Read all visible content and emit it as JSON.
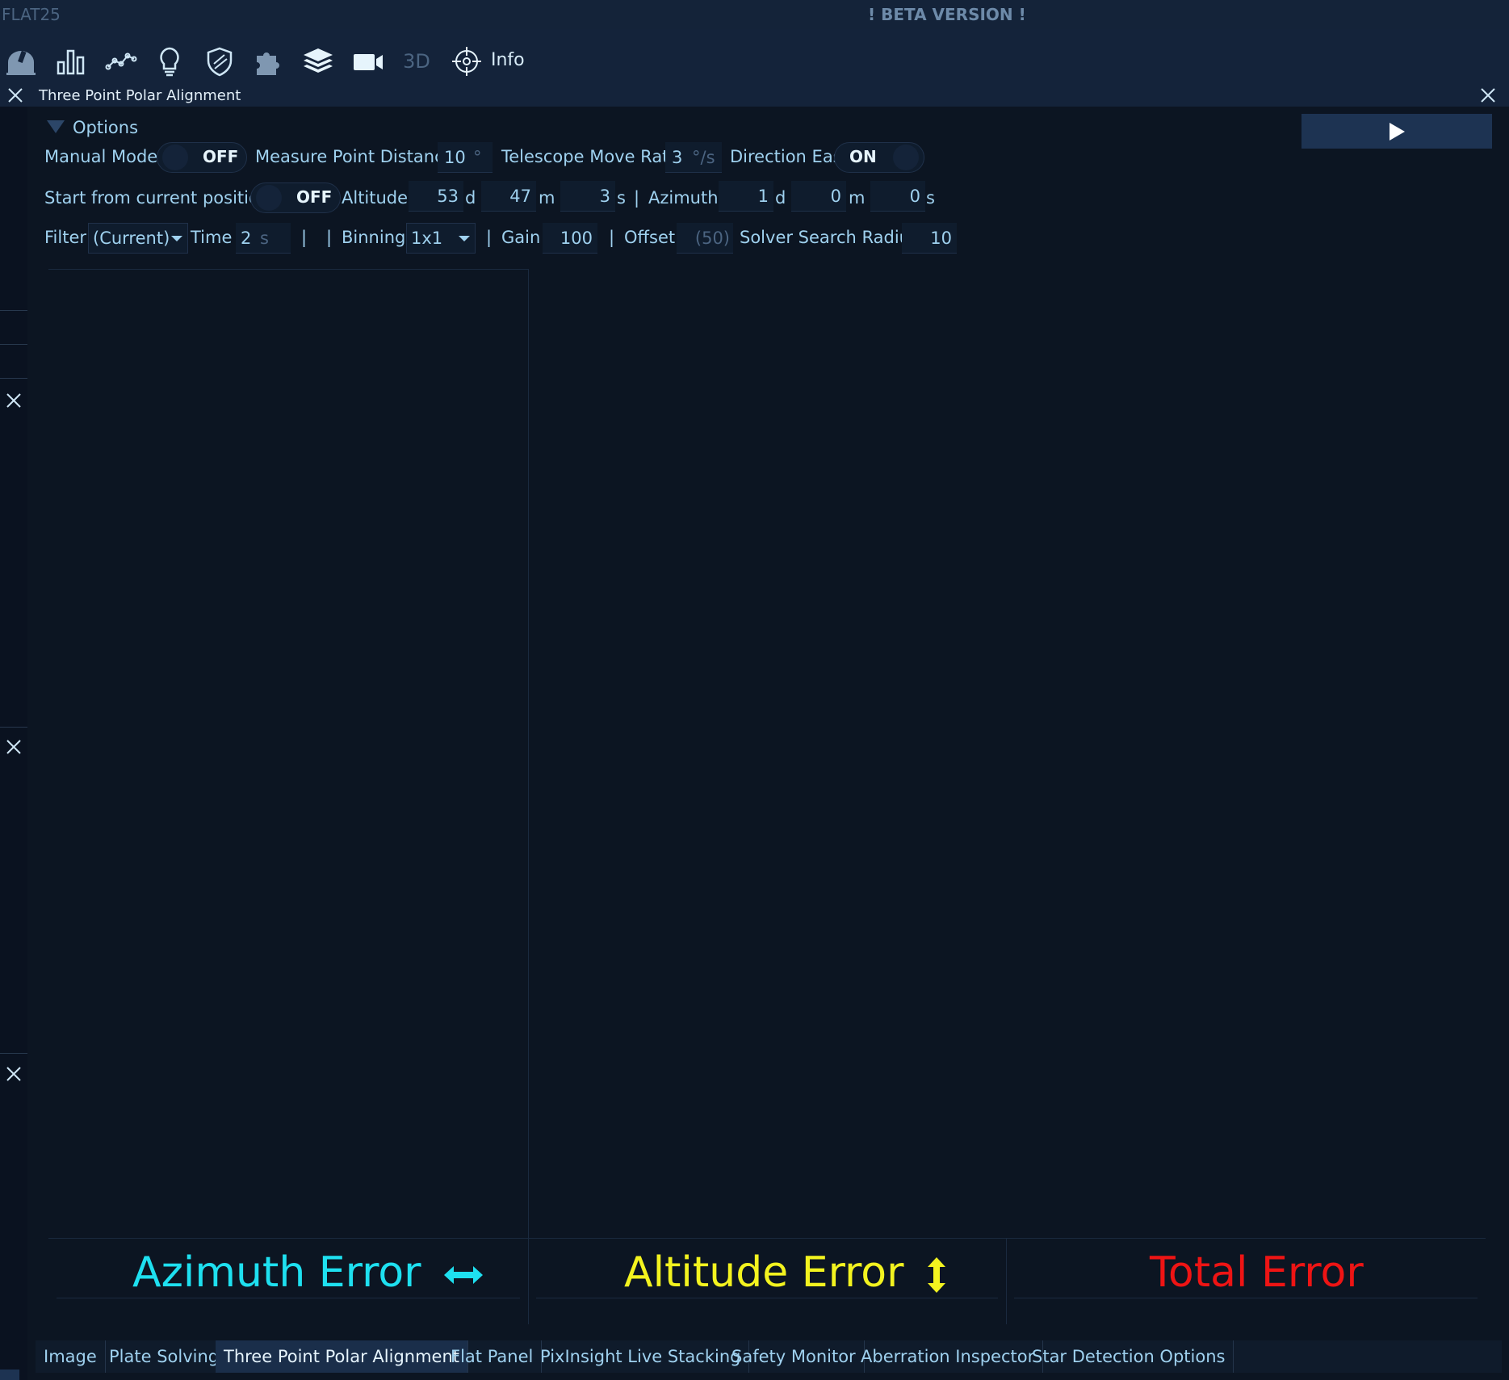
{
  "titlebar": {
    "app_name": "FLAT25",
    "banner": "! BETA VERSION !"
  },
  "toolbar": {
    "icons": [
      "observatory-icon",
      "bar-chart-icon",
      "graph-icon",
      "lightbulb-icon",
      "shield-icon",
      "puzzle-icon",
      "layers-icon",
      "video-camera-icon",
      "3d-icon",
      "crosshair-icon"
    ],
    "three_d_label": "3D",
    "info_label": "Info"
  },
  "panel": {
    "title": "Three Point Polar Alignment"
  },
  "options": {
    "header": "Options",
    "manual_mode_label": "Manual Mode?",
    "manual_mode_state": "OFF",
    "measure_point_distance_label": "Measure Point Distance",
    "measure_point_distance_value": "10",
    "measure_point_distance_unit": "°",
    "telescope_move_rate_label": "Telescope Move Rate",
    "telescope_move_rate_value": "3",
    "telescope_move_rate_unit": "°/s",
    "direction_east_label": "Direction East",
    "direction_east_state": "ON",
    "start_from_current_label": "Start from current position?",
    "start_from_current_state": "OFF",
    "altitude_label": "Altitude",
    "altitude_d": "53",
    "altitude_m": "47",
    "altitude_s": "3",
    "unit_d": "d",
    "unit_m": "m",
    "unit_s": "s",
    "pipe": "|",
    "azimuth_label": "Azimuth",
    "azimuth_d": "1",
    "azimuth_m": "0",
    "azimuth_s": "0",
    "filter_label": "Filter",
    "filter_value": "(Current)",
    "time_label": "Time",
    "time_value": "2",
    "time_unit": "s",
    "binning_label": "Binning",
    "binning_value": "1x1",
    "gain_label": "Gain",
    "gain_value": "100",
    "offset_label": "Offset",
    "offset_placeholder": "(50)",
    "solver_radius_label": "Solver Search Radius",
    "solver_radius_value": "10"
  },
  "errors": {
    "azimuth": "Azimuth Error",
    "altitude": "Altitude Error",
    "total": "Total Error",
    "azimuth_color": "#1ee0f0",
    "altitude_color": "#f3f31f",
    "total_color": "#ee1414"
  },
  "tabs": [
    {
      "label": "Image"
    },
    {
      "label": "Plate Solving"
    },
    {
      "label": "Three Point Polar Alignment"
    },
    {
      "label": "Flat Panel"
    },
    {
      "label": "PixInsight Live Stacking"
    },
    {
      "label": "Safety Monitor"
    },
    {
      "label": "Aberration Inspector"
    },
    {
      "label": "Star Detection Options"
    }
  ],
  "active_tab": "Three Point Polar Alignment"
}
